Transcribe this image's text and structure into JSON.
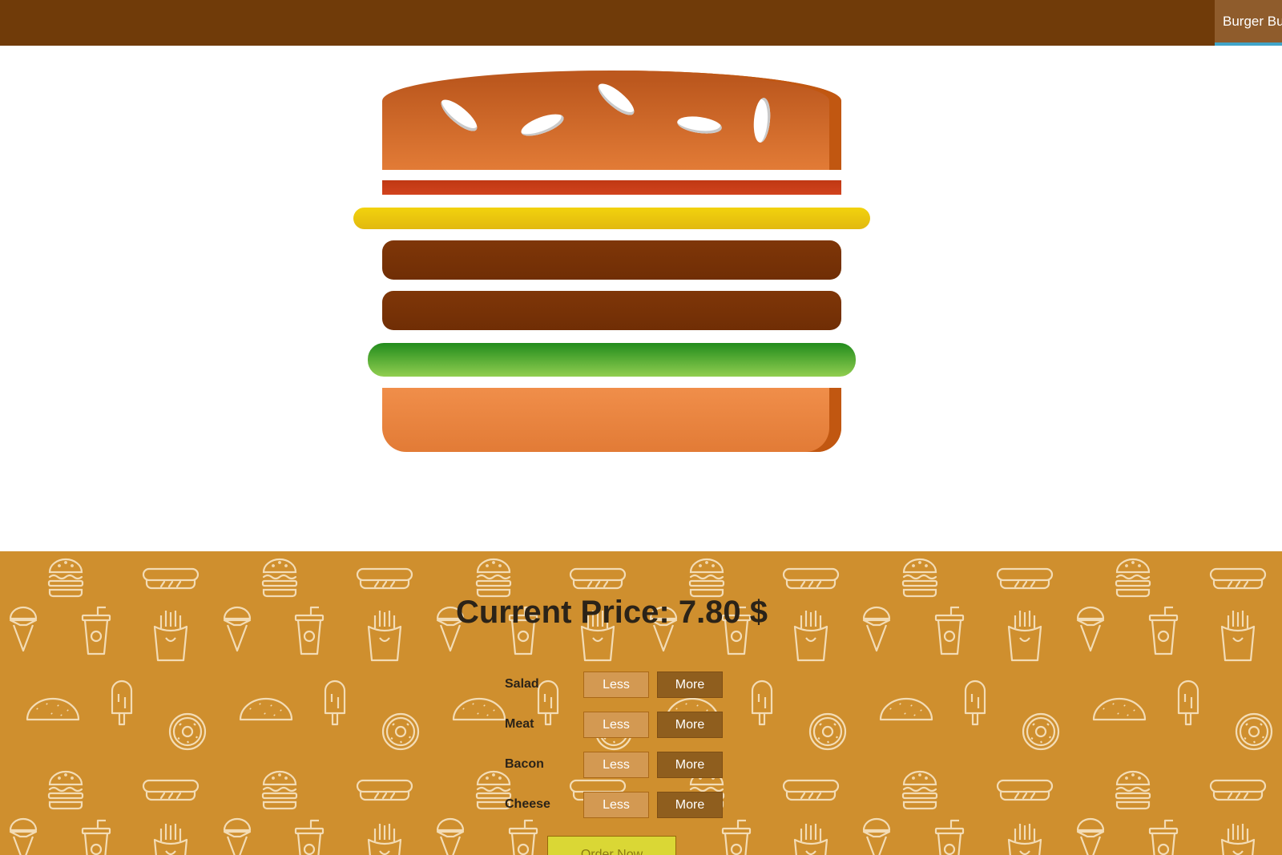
{
  "toolbar": {
    "nav_label": "Burger Builder"
  },
  "price": {
    "label": "Current Price: 7.80 $"
  },
  "controls": [
    {
      "label": "Salad",
      "less": "Less",
      "more": "More"
    },
    {
      "label": "Meat",
      "less": "Less",
      "more": "More"
    },
    {
      "label": "Bacon",
      "less": "Less",
      "more": "More"
    },
    {
      "label": "Cheese",
      "less": "Less",
      "more": "More"
    }
  ],
  "order_button": {
    "label": "Order Now"
  },
  "burger": {
    "ingredients": [
      "bread-top",
      "bacon",
      "cheese",
      "meat",
      "meat",
      "salad",
      "bread-bottom"
    ]
  },
  "colors": {
    "toolbar": "#703b09",
    "controls_background": "#cf8f2e",
    "less_button": "#d39952",
    "more_button": "#8f5e1e",
    "order_button": "#dad735"
  },
  "icons": [
    "burger-icon",
    "hotdog-icon",
    "icecream-icon",
    "drink-cup-icon",
    "fries-icon",
    "taco-icon",
    "popsicle-icon",
    "donut-icon"
  ]
}
